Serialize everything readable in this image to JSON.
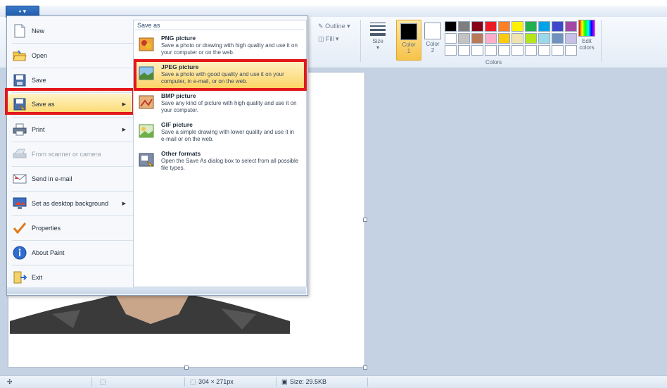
{
  "file_tab": {
    "label": "▪ ▾"
  },
  "ribbon": {
    "outline_label": "Outline",
    "fill_label": "Fill",
    "size_label": "Size",
    "color1_label": "Color",
    "color1_num": "1",
    "color2_label": "Color",
    "color2_num": "2",
    "edit_colors_label": "Edit",
    "edit_colors_label2": "colors",
    "colors_group_label": "Colors",
    "color1_value": "#000000",
    "color2_value": "#ffffff",
    "palette": [
      "#000000",
      "#7f7f7f",
      "#880015",
      "#ed1c24",
      "#ff7f27",
      "#fff200",
      "#22b14c",
      "#00a2e8",
      "#3f48cc",
      "#a349a4",
      "#ffffff",
      "#c3c3c3",
      "#b97a57",
      "#ffaec9",
      "#ffc90e",
      "#efe4b0",
      "#b5e61d",
      "#99d9ea",
      "#7092be",
      "#c8bfe7",
      "#ffffff",
      "#ffffff",
      "#ffffff",
      "#ffffff",
      "#ffffff",
      "#ffffff",
      "#ffffff",
      "#ffffff",
      "#ffffff",
      "#ffffff"
    ]
  },
  "file_menu": {
    "items": [
      {
        "label": "New",
        "icon": "new-document-icon"
      },
      {
        "label": "Open",
        "icon": "open-folder-icon"
      },
      {
        "label": "Save",
        "icon": "save-disk-icon"
      },
      {
        "label": "Save as",
        "icon": "save-as-icon"
      },
      {
        "label": "Print",
        "icon": "printer-icon"
      },
      {
        "label": "From scanner or camera",
        "icon": "scanner-icon"
      },
      {
        "label": "Send in e-mail",
        "icon": "email-icon"
      },
      {
        "label": "Set as desktop background",
        "icon": "desktop-background-icon"
      },
      {
        "label": "Properties",
        "icon": "checkmark-icon"
      },
      {
        "label": "About Paint",
        "icon": "info-icon"
      },
      {
        "label": "Exit",
        "icon": "exit-icon"
      }
    ]
  },
  "save_as_menu": {
    "title": "Save as",
    "options": [
      {
        "title": "PNG picture",
        "desc": "Save a photo or drawing with high quality and use it on your computer or on the web.",
        "icon": "png-picture-icon"
      },
      {
        "title": "JPEG picture",
        "desc": "Save a photo with good quality and use it on your computer, in e-mail, or on the web.",
        "icon": "jpeg-picture-icon"
      },
      {
        "title": "BMP picture",
        "desc": "Save any kind of picture with high quality and use it on your computer.",
        "icon": "bmp-picture-icon"
      },
      {
        "title": "GIF picture",
        "desc": "Save a simple drawing with lower quality and use it in e-mail or on the web.",
        "icon": "gif-picture-icon"
      },
      {
        "title": "Other formats",
        "desc": "Open the Save As dialog box to select from all possible file types.",
        "icon": "other-formats-icon"
      }
    ]
  },
  "status_bar": {
    "dimensions": "304 × 271px",
    "size": "Size: 29.5KB"
  }
}
